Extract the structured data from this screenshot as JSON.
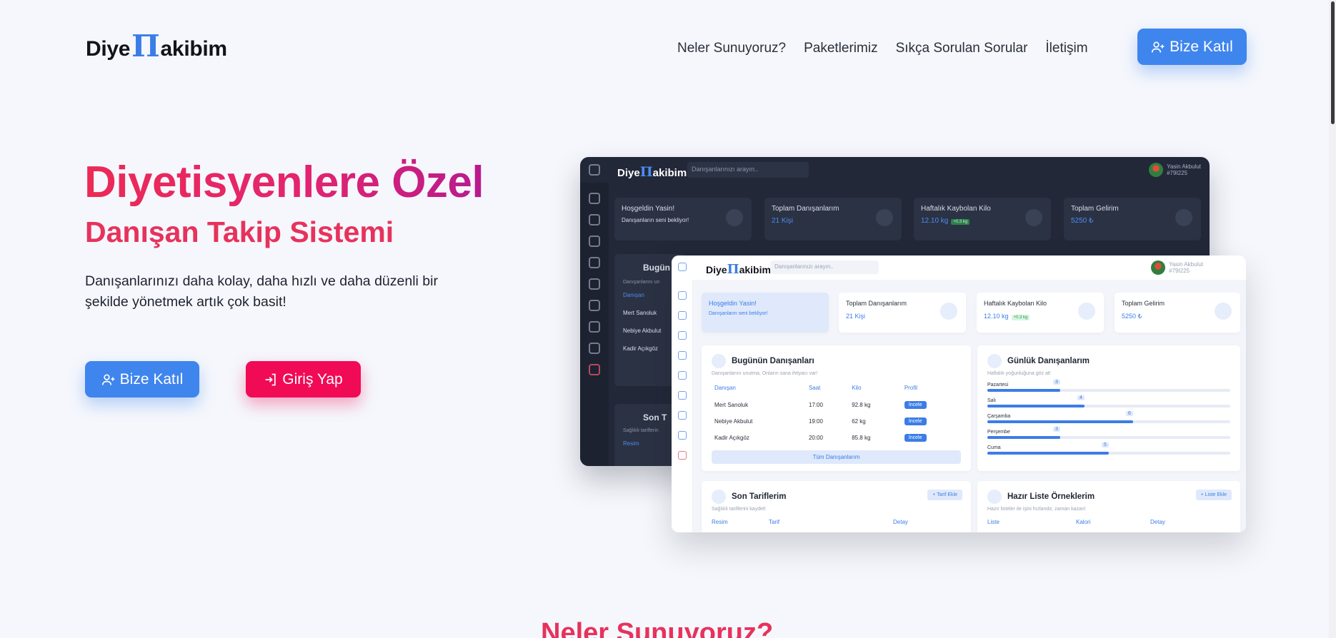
{
  "brand": {
    "pre": "Diye",
    "pi": "Π",
    "post": "akibim"
  },
  "nav": {
    "items": [
      "Neler Sunuyoruz?",
      "Paketlerimiz",
      "Sıkça Sorulan Sorular",
      "İletişim"
    ],
    "join_label": "Bize Katıl"
  },
  "hero": {
    "title": "Diyetisyenlere Özel",
    "subtitle": "Danışan Takip Sistemi",
    "description": "Danışanlarınızı daha kolay, daha hızlı ve daha düzenli bir şekilde yönetmek artık çok basit!",
    "join_label": "Bize Katıl",
    "login_label": "Giriş Yap"
  },
  "next_section_title": "Neler Sunuyoruz?",
  "mockup": {
    "search_placeholder": "Danışanlarınızı arayın..",
    "user_name": "Yasin Akbulut",
    "user_id": "#79I225",
    "cards": {
      "welcome_title": "Hoşgeldin Yasin!",
      "welcome_sub": "Danışanların seni bekliyor!",
      "clients_title": "Toplam Danışanlarım",
      "clients_value": "21 Kişi",
      "weight_title": "Haftalık Kaybolan Kilo",
      "weight_value": "12.10 kg",
      "weight_badge": "+0.3 kg",
      "income_title": "Toplam Gelirim",
      "income_value": "5250 ₺"
    },
    "today": {
      "title": "Bugünün Danışanları",
      "sub": "Danışanlarını unutma, Onların sana ihtiyacı var!",
      "columns": [
        "Danışan",
        "Saat",
        "Kilo",
        "Profil"
      ],
      "rows": [
        {
          "name": "Mert Sanoluk",
          "time": "17:00",
          "kg": "92.8 kg",
          "action": "İncele"
        },
        {
          "name": "Nebiye Akbulut",
          "time": "19:00",
          "kg": "62 kg",
          "action": "İncele"
        },
        {
          "name": "Kadir Açıkgöz",
          "time": "20:00",
          "kg": "85.8 kg",
          "action": "İncele"
        }
      ],
      "all_button": "Tüm Danışanlarım"
    },
    "daily": {
      "title": "Günlük Danışanlarım",
      "sub": "Haftalık yoğunluğuna göz at!",
      "days": [
        {
          "label": "Pazartesi",
          "value": 3
        },
        {
          "label": "Salı",
          "value": 4
        },
        {
          "label": "Çarşamba",
          "value": 6
        },
        {
          "label": "Perşembe",
          "value": 3
        },
        {
          "label": "Cuma",
          "value": 5
        }
      ]
    },
    "recipes": {
      "title": "Son Tariflerim",
      "sub": "Sağlıklı tariflerini kaydet!",
      "add": "+ Tarif Ekle",
      "columns": [
        "Resim",
        "Tarif",
        "Detay"
      ]
    },
    "lists": {
      "title": "Hazır Liste Örneklerim",
      "sub": "Hazır listeler ile işini hızlandır, zaman kazan!",
      "add": "+ Liste Ekle",
      "columns": [
        "Liste",
        "Kalori",
        "Detay"
      ]
    },
    "dark_panel_title": "Bugün",
    "dark_panel_sub": "Danışanlarını un",
    "dark_panel_col": "Danışan",
    "dark_panel_rows": [
      "Mert Sanoluk",
      "Nebiye Akbulut",
      "Kadir Açıkgöz"
    ],
    "dark_panel2_title": "Son T",
    "dark_panel2_sub": "Sağlıklı tariflerin",
    "dark_panel2_col": "Resim"
  },
  "colors": {
    "primary": "#3f85ee",
    "danger": "#f10a56",
    "heading": "#e7325c"
  }
}
